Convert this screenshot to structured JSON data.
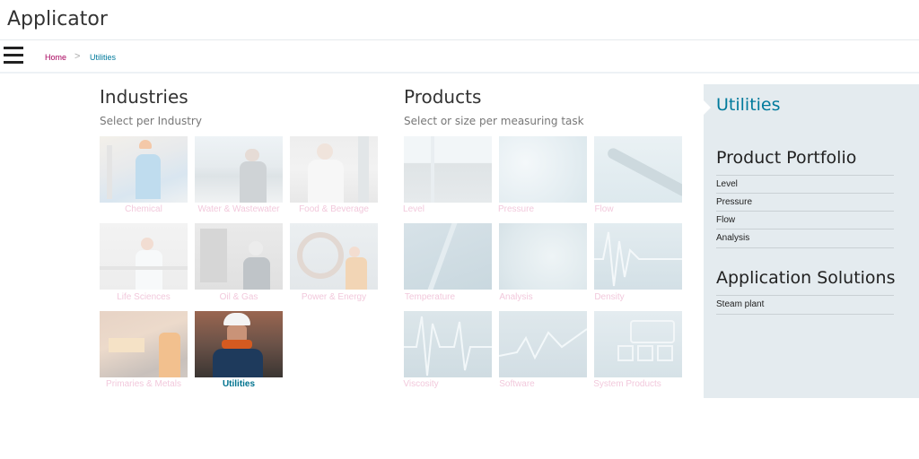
{
  "app": {
    "title": "Applicator"
  },
  "breadcrumb": {
    "home": "Home",
    "separator": ">",
    "current": "Utilities"
  },
  "industries": {
    "title": "Industries",
    "subtitle": "Select per Industry",
    "tiles": [
      {
        "label": "Chemical"
      },
      {
        "label": "Water & Wastewater"
      },
      {
        "label": "Food & Beverage"
      },
      {
        "label": "Life Sciences"
      },
      {
        "label": "Oil & Gas"
      },
      {
        "label": "Power & Energy"
      },
      {
        "label": "Primaries & Metals"
      },
      {
        "label": "Utilities"
      }
    ]
  },
  "products": {
    "title": "Products",
    "subtitle": "Select or size per measuring task",
    "tiles": [
      {
        "label": "Level"
      },
      {
        "label": "Pressure"
      },
      {
        "label": "Flow"
      },
      {
        "label": "Temperature"
      },
      {
        "label": "Analysis"
      },
      {
        "label": "Density"
      },
      {
        "label": "Viscosity"
      },
      {
        "label": "Software"
      },
      {
        "label": "System Products"
      }
    ]
  },
  "panel": {
    "title": "Utilities",
    "portfolio_heading": "Product Portfolio",
    "portfolio_items": [
      "Level",
      "Pressure",
      "Flow",
      "Analysis"
    ],
    "solutions_heading": "Application Solutions",
    "solutions_items": [
      "Steam plant"
    ]
  },
  "colors": {
    "accent": "#007a9c",
    "breadcrumb_home": "#a8005c",
    "panel_bg": "#e4ebef",
    "inactive_label": "#f2c9dc"
  }
}
